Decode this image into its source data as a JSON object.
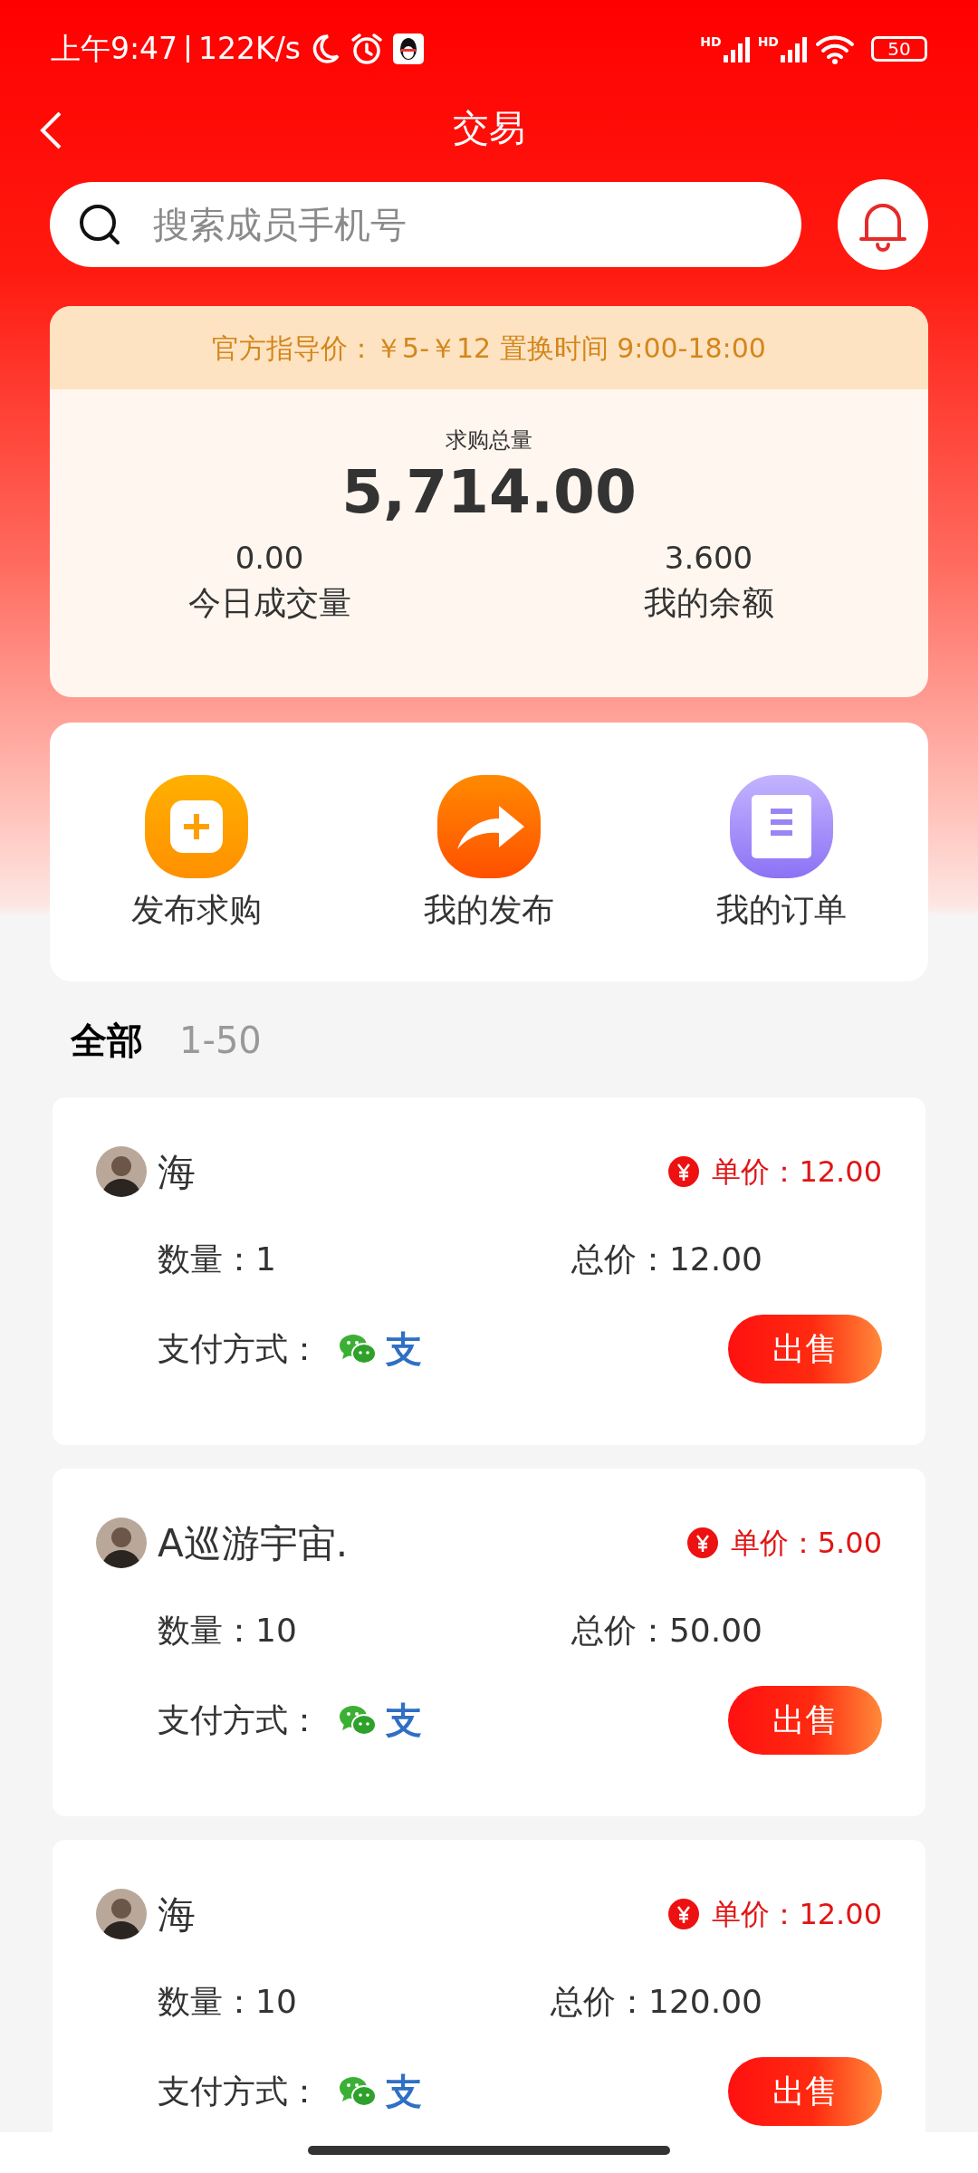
{
  "status_bar": {
    "time": "上午9:47",
    "speed": "122K/s",
    "signal_labels": [
      "HD",
      "HD"
    ],
    "battery": "50"
  },
  "header": {
    "title": "交易"
  },
  "search": {
    "placeholder": "搜索成员手机号"
  },
  "summary": {
    "notice": "官方指导价：￥5-￥12 置换时间 9:00-18:00",
    "total_label": "求购总量",
    "total_value": "5,714.00",
    "stats": [
      {
        "value": "0.00",
        "label": "今日成交量"
      },
      {
        "value": "3.600",
        "label": "我的余额"
      }
    ]
  },
  "actions": [
    {
      "kind": "plus",
      "label": "发布求购"
    },
    {
      "kind": "share",
      "label": "我的发布"
    },
    {
      "kind": "document",
      "label": "我的订单"
    }
  ],
  "list_header": {
    "title": "全部",
    "range": "1-50"
  },
  "orders": [
    {
      "name": "海",
      "unit_price": "单价：12.00",
      "quantity": "数量：1",
      "total": "总价：12.00",
      "payment_label": "支付方式：",
      "payment_methods": [
        {
          "kind": "wechat"
        },
        {
          "kind": "alipay",
          "glyph": "支"
        }
      ],
      "button": "出售"
    },
    {
      "name": "A巡游宇宙.",
      "unit_price": "单价：5.00",
      "quantity": "数量：10",
      "total": "总价：50.00",
      "payment_label": "支付方式：",
      "payment_methods": [
        {
          "kind": "wechat"
        },
        {
          "kind": "alipay",
          "glyph": "支"
        }
      ],
      "button": "出售"
    },
    {
      "name": "海",
      "unit_price": "单价：12.00",
      "quantity": "数量：10",
      "total": "总价：120.00",
      "payment_label": "支付方式：",
      "payment_methods": [
        {
          "kind": "wechat"
        },
        {
          "kind": "alipay",
          "glyph": "支"
        }
      ],
      "button": "出售"
    }
  ]
}
